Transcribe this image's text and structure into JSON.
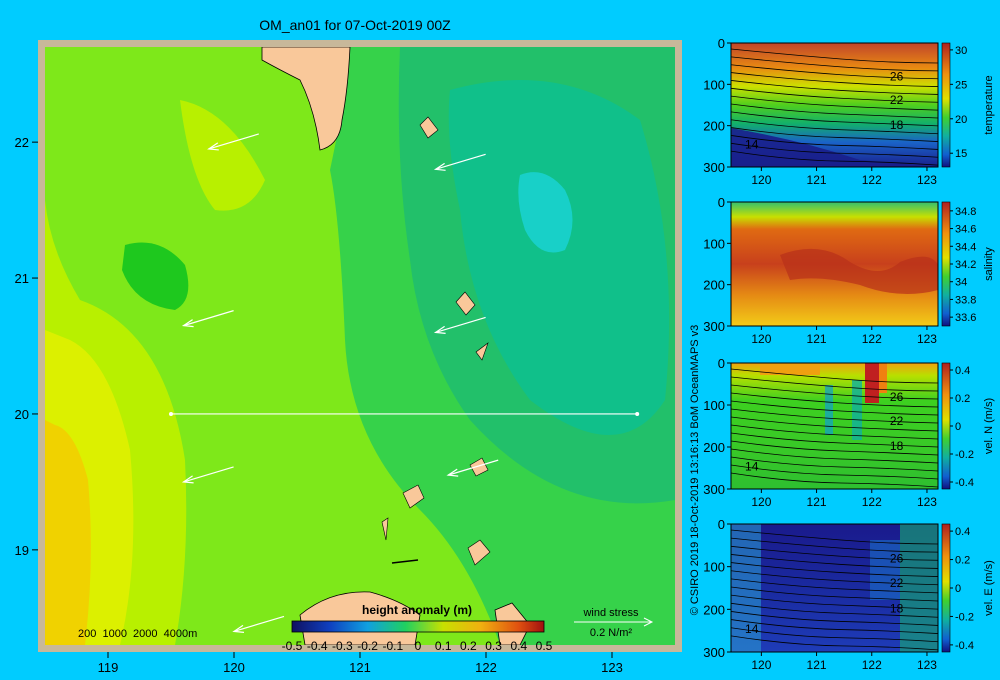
{
  "title": "OM_an01 for 07-Oct-2019 00Z",
  "credit": "© CSIRO 2019  18-Oct-2019 13:16:13 BoM OceanMAPS v3",
  "colors": {
    "background": "#00ccff",
    "land": "#f9c89a",
    "frame": "#c8b89a",
    "arrow": "#ffffff"
  },
  "chart_data": [
    {
      "type": "heatmap",
      "name": "height anomaly map",
      "xlim": [
        118.5,
        123.5
      ],
      "ylim": [
        18.3,
        22.7
      ],
      "xticks": [
        "119",
        "120",
        "121",
        "122",
        "123"
      ],
      "yticks": [
        "19",
        "20",
        "21",
        "22"
      ],
      "colorbar": {
        "label": "height anomaly (m)",
        "ticks": [
          "-0.5",
          "-0.4",
          "-0.3",
          "-0.2",
          "-0.1",
          "0",
          "0.1",
          "0.2",
          "0.3",
          "0.4",
          "0.5"
        ],
        "range": [
          -0.5,
          0.5
        ]
      },
      "depth_contours_label": "200  1000  2000  4000m",
      "wind_legend": {
        "title": "wind stress",
        "value": "0.2 N/m²"
      },
      "section_line": {
        "from": [
          119.5,
          20.0
        ],
        "to": [
          123.2,
          20.0
        ]
      },
      "wind_vectors": [
        {
          "x": 119.8,
          "y": 21.95
        },
        {
          "x": 121.6,
          "y": 21.8
        },
        {
          "x": 119.6,
          "y": 20.65
        },
        {
          "x": 121.6,
          "y": 20.6
        },
        {
          "x": 119.6,
          "y": 19.5
        },
        {
          "x": 121.7,
          "y": 19.55
        },
        {
          "x": 120.0,
          "y": 18.4
        }
      ]
    },
    {
      "type": "heatmap",
      "name": "temperature section",
      "xticks": [
        "120",
        "121",
        "122",
        "123"
      ],
      "yticks": [
        "0",
        "100",
        "200",
        "300"
      ],
      "ylim": [
        300,
        0
      ],
      "colorbar": {
        "label": "temperature",
        "ticks": [
          "30",
          "25",
          "20",
          "15"
        ],
        "range": [
          13,
          31
        ]
      },
      "contour_labels": [
        "26",
        "22",
        "18",
        "14"
      ]
    },
    {
      "type": "heatmap",
      "name": "salinity section",
      "xticks": [
        "120",
        "121",
        "122",
        "123"
      ],
      "yticks": [
        "0",
        "100",
        "200",
        "300"
      ],
      "ylim": [
        300,
        0
      ],
      "colorbar": {
        "label": "salinity",
        "ticks": [
          "34.8",
          "34.6",
          "34.4",
          "34.2",
          "34",
          "33.8",
          "33.6"
        ],
        "range": [
          33.5,
          34.9
        ]
      }
    },
    {
      "type": "heatmap",
      "name": "northward velocity section",
      "xticks": [
        "120",
        "121",
        "122",
        "123"
      ],
      "yticks": [
        "0",
        "100",
        "200",
        "300"
      ],
      "ylim": [
        300,
        0
      ],
      "colorbar": {
        "label": "vel. N  (m/s)",
        "ticks": [
          "0.4",
          "0.2",
          "0",
          "-0.2",
          "-0.4"
        ],
        "range": [
          -0.45,
          0.45
        ]
      },
      "contour_labels": [
        "26",
        "22",
        "18",
        "14"
      ]
    },
    {
      "type": "heatmap",
      "name": "eastward velocity section",
      "xticks": [
        "120",
        "121",
        "122",
        "123"
      ],
      "yticks": [
        "0",
        "100",
        "200",
        "300"
      ],
      "ylim": [
        300,
        0
      ],
      "colorbar": {
        "label": "vel. E  (m/s)",
        "ticks": [
          "0.4",
          "0.2",
          "0",
          "-0.2",
          "-0.4"
        ],
        "range": [
          -0.45,
          0.45
        ]
      },
      "contour_labels": [
        "26",
        "22",
        "18",
        "14"
      ]
    }
  ]
}
